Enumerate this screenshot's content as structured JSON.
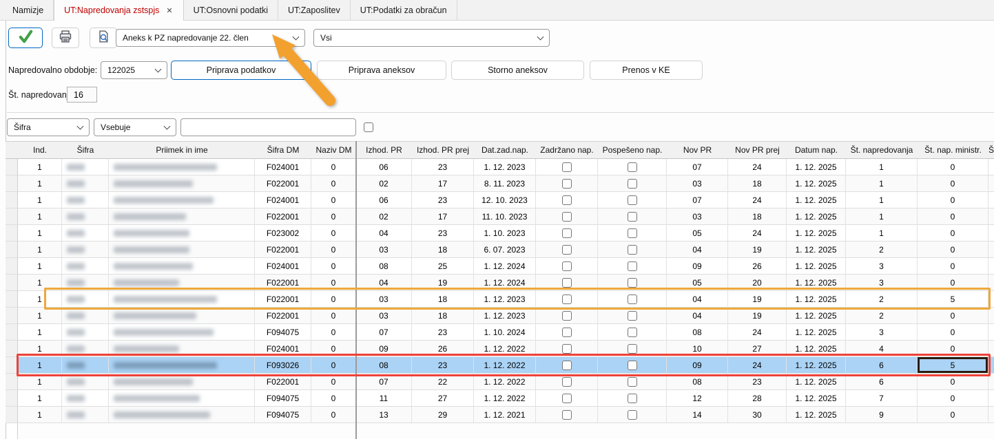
{
  "tabs": [
    {
      "label": "Namizje",
      "active": false,
      "closable": false
    },
    {
      "label": "UT:Napredovanja zstspjs",
      "active": true,
      "closable": true
    },
    {
      "label": "UT:Osnovni podatki",
      "active": false,
      "closable": false
    },
    {
      "label": "UT:Zaposlitev",
      "active": false,
      "closable": false
    },
    {
      "label": "UT:Podatki za obračun",
      "active": false,
      "closable": false
    }
  ],
  "toolbar": {
    "confirm_icon": "green-checkmark",
    "print_icon": "printer",
    "preview_icon": "document-magnifier",
    "document_type": "Aneks k PZ napredovanje 22. člen",
    "scope": "Vsi"
  },
  "controls": {
    "period_label": "Napredovalno obdobje:",
    "period_value": "122025",
    "buttons": [
      "Priprava podatkov",
      "Priprava aneksov",
      "Storno aneksov",
      "Prenos v KE"
    ],
    "focused_button": "Priprava podatkov",
    "count_label": "Št. napredovanj:",
    "count_value": "16"
  },
  "search": {
    "field": "Šifra",
    "operator": "Vsebuje",
    "query": "",
    "checkbox_checked": false
  },
  "table": {
    "columns": [
      {
        "key": "sel",
        "label": ""
      },
      {
        "key": "ind",
        "label": "Ind."
      },
      {
        "key": "sifra",
        "label": "Šifra"
      },
      {
        "key": "priimek",
        "label": "Priimek in ime"
      },
      {
        "key": "sifra_dm",
        "label": "Šifra DM"
      },
      {
        "key": "naziv_dm",
        "label": "Naziv DM"
      },
      {
        "key": "izhod_pr",
        "label": "Izhod. PR"
      },
      {
        "key": "izhod_pr_prej",
        "label": "Izhod. PR prej"
      },
      {
        "key": "dat_zad_nap",
        "label": "Dat.zad.nap."
      },
      {
        "key": "zadrzano_nap",
        "label": "Zadržano nap."
      },
      {
        "key": "pospeseno_nap",
        "label": "Pospešeno nap."
      },
      {
        "key": "nov_pr",
        "label": "Nov PR"
      },
      {
        "key": "nov_pr_prej",
        "label": "Nov PR prej"
      },
      {
        "key": "datum_nap",
        "label": "Datum nap."
      },
      {
        "key": "st_napredovanja",
        "label": "Št. napredovanja"
      },
      {
        "key": "st_nap_ministr",
        "label": "Št. nap. ministr."
      },
      {
        "key": "partial",
        "label": "Š"
      }
    ],
    "redacted_columns": [
      "sifra",
      "priimek"
    ],
    "selected_row": 13,
    "orange_outline_row": 9,
    "red_outline_row": 13,
    "black_outline_cell": {
      "row": 13,
      "column": "st_nap_ministr"
    },
    "rows": [
      {
        "ind": "1",
        "sifra": "",
        "priimek": "",
        "sifra_dm": "F024001",
        "naziv_dm": "0",
        "izhod_pr": "06",
        "izhod_pr_prej": "23",
        "dat_zad_nap": "1. 12. 2023",
        "zadrzano_nap": false,
        "pospeseno_nap": false,
        "nov_pr": "07",
        "nov_pr_prej": "24",
        "datum_nap": "1. 12. 2025",
        "st_napredovanja": "1",
        "st_nap_ministr": "0"
      },
      {
        "ind": "1",
        "sifra": "",
        "priimek": "",
        "sifra_dm": "F022001",
        "naziv_dm": "0",
        "izhod_pr": "02",
        "izhod_pr_prej": "17",
        "dat_zad_nap": "8. 11. 2023",
        "zadrzano_nap": false,
        "pospeseno_nap": false,
        "nov_pr": "03",
        "nov_pr_prej": "18",
        "datum_nap": "1. 12. 2025",
        "st_napredovanja": "1",
        "st_nap_ministr": "0"
      },
      {
        "ind": "1",
        "sifra": "",
        "priimek": "",
        "sifra_dm": "F024001",
        "naziv_dm": "0",
        "izhod_pr": "06",
        "izhod_pr_prej": "23",
        "dat_zad_nap": "12. 10. 2023",
        "zadrzano_nap": false,
        "pospeseno_nap": false,
        "nov_pr": "07",
        "nov_pr_prej": "24",
        "datum_nap": "1. 12. 2025",
        "st_napredovanja": "1",
        "st_nap_ministr": "0"
      },
      {
        "ind": "1",
        "sifra": "",
        "priimek": "",
        "sifra_dm": "F022001",
        "naziv_dm": "0",
        "izhod_pr": "02",
        "izhod_pr_prej": "17",
        "dat_zad_nap": "11. 10. 2023",
        "zadrzano_nap": false,
        "pospeseno_nap": false,
        "nov_pr": "03",
        "nov_pr_prej": "18",
        "datum_nap": "1. 12. 2025",
        "st_napredovanja": "1",
        "st_nap_ministr": "0"
      },
      {
        "ind": "1",
        "sifra": "",
        "priimek": "",
        "sifra_dm": "F023002",
        "naziv_dm": "0",
        "izhod_pr": "04",
        "izhod_pr_prej": "23",
        "dat_zad_nap": "1. 10. 2023",
        "zadrzano_nap": false,
        "pospeseno_nap": false,
        "nov_pr": "05",
        "nov_pr_prej": "24",
        "datum_nap": "1. 12. 2025",
        "st_napredovanja": "1",
        "st_nap_ministr": "0"
      },
      {
        "ind": "1",
        "sifra": "",
        "priimek": "",
        "sifra_dm": "F022001",
        "naziv_dm": "0",
        "izhod_pr": "03",
        "izhod_pr_prej": "18",
        "dat_zad_nap": "6. 07. 2023",
        "zadrzano_nap": false,
        "pospeseno_nap": false,
        "nov_pr": "04",
        "nov_pr_prej": "19",
        "datum_nap": "1. 12. 2025",
        "st_napredovanja": "2",
        "st_nap_ministr": "0"
      },
      {
        "ind": "1",
        "sifra": "",
        "priimek": "",
        "sifra_dm": "F024001",
        "naziv_dm": "0",
        "izhod_pr": "08",
        "izhod_pr_prej": "25",
        "dat_zad_nap": "1. 12. 2024",
        "zadrzano_nap": false,
        "pospeseno_nap": false,
        "nov_pr": "09",
        "nov_pr_prej": "26",
        "datum_nap": "1. 12. 2025",
        "st_napredovanja": "3",
        "st_nap_ministr": "0"
      },
      {
        "ind": "1",
        "sifra": "",
        "priimek": "",
        "sifra_dm": "F022001",
        "naziv_dm": "0",
        "izhod_pr": "04",
        "izhod_pr_prej": "19",
        "dat_zad_nap": "1. 12. 2024",
        "zadrzano_nap": false,
        "pospeseno_nap": false,
        "nov_pr": "05",
        "nov_pr_prej": "20",
        "datum_nap": "1. 12. 2025",
        "st_napredovanja": "3",
        "st_nap_ministr": "0"
      },
      {
        "ind": "1",
        "sifra": "",
        "priimek": "",
        "sifra_dm": "F022001",
        "naziv_dm": "0",
        "izhod_pr": "03",
        "izhod_pr_prej": "18",
        "dat_zad_nap": "1. 12. 2023",
        "zadrzano_nap": false,
        "pospeseno_nap": false,
        "nov_pr": "04",
        "nov_pr_prej": "19",
        "datum_nap": "1. 12. 2025",
        "st_napredovanja": "2",
        "st_nap_ministr": "5"
      },
      {
        "ind": "1",
        "sifra": "",
        "priimek": "",
        "sifra_dm": "F022001",
        "naziv_dm": "0",
        "izhod_pr": "03",
        "izhod_pr_prej": "18",
        "dat_zad_nap": "1. 12. 2023",
        "zadrzano_nap": false,
        "pospeseno_nap": false,
        "nov_pr": "04",
        "nov_pr_prej": "19",
        "datum_nap": "1. 12. 2025",
        "st_napredovanja": "2",
        "st_nap_ministr": "0"
      },
      {
        "ind": "1",
        "sifra": "",
        "priimek": "",
        "sifra_dm": "F094075",
        "naziv_dm": "0",
        "izhod_pr": "07",
        "izhod_pr_prej": "23",
        "dat_zad_nap": "1. 10. 2024",
        "zadrzano_nap": false,
        "pospeseno_nap": false,
        "nov_pr": "08",
        "nov_pr_prej": "24",
        "datum_nap": "1. 12. 2025",
        "st_napredovanja": "3",
        "st_nap_ministr": "0"
      },
      {
        "ind": "1",
        "sifra": "",
        "priimek": "",
        "sifra_dm": "F024001",
        "naziv_dm": "0",
        "izhod_pr": "09",
        "izhod_pr_prej": "26",
        "dat_zad_nap": "1. 12. 2022",
        "zadrzano_nap": false,
        "pospeseno_nap": false,
        "nov_pr": "10",
        "nov_pr_prej": "27",
        "datum_nap": "1. 12. 2025",
        "st_napredovanja": "4",
        "st_nap_ministr": "0"
      },
      {
        "ind": "1",
        "sifra": "",
        "priimek": "",
        "sifra_dm": "F093026",
        "naziv_dm": "0",
        "izhod_pr": "08",
        "izhod_pr_prej": "23",
        "dat_zad_nap": "1. 12. 2022",
        "zadrzano_nap": false,
        "pospeseno_nap": false,
        "nov_pr": "09",
        "nov_pr_prej": "24",
        "datum_nap": "1. 12. 2025",
        "st_napredovanja": "6",
        "st_nap_ministr": "5"
      },
      {
        "ind": "1",
        "sifra": "",
        "priimek": "",
        "sifra_dm": "F022001",
        "naziv_dm": "0",
        "izhod_pr": "07",
        "izhod_pr_prej": "22",
        "dat_zad_nap": "1. 12. 2022",
        "zadrzano_nap": false,
        "pospeseno_nap": false,
        "nov_pr": "08",
        "nov_pr_prej": "23",
        "datum_nap": "1. 12. 2025",
        "st_napredovanja": "6",
        "st_nap_ministr": "0"
      },
      {
        "ind": "1",
        "sifra": "",
        "priimek": "",
        "sifra_dm": "F094075",
        "naziv_dm": "0",
        "izhod_pr": "11",
        "izhod_pr_prej": "27",
        "dat_zad_nap": "1. 12. 2022",
        "zadrzano_nap": false,
        "pospeseno_nap": false,
        "nov_pr": "12",
        "nov_pr_prej": "28",
        "datum_nap": "1. 12. 2025",
        "st_napredovanja": "7",
        "st_nap_ministr": "0"
      },
      {
        "ind": "1",
        "sifra": "",
        "priimek": "",
        "sifra_dm": "F094075",
        "naziv_dm": "0",
        "izhod_pr": "13",
        "izhod_pr_prej": "29",
        "dat_zad_nap": "1. 12. 2021",
        "zadrzano_nap": false,
        "pospeseno_nap": false,
        "nov_pr": "14",
        "nov_pr_prej": "30",
        "datum_nap": "1. 12. 2025",
        "st_napredovanja": "9",
        "st_nap_ministr": "0"
      }
    ]
  },
  "colors": {
    "selection_blue": "#abd3f5",
    "orange_highlight": "#eda83c",
    "red_highlight": "#ee4238",
    "arrow_orange": "#f2a12f",
    "focus_blue": "#0067c0",
    "active_tab_text": "#c00000",
    "check_green": "#43a047"
  }
}
